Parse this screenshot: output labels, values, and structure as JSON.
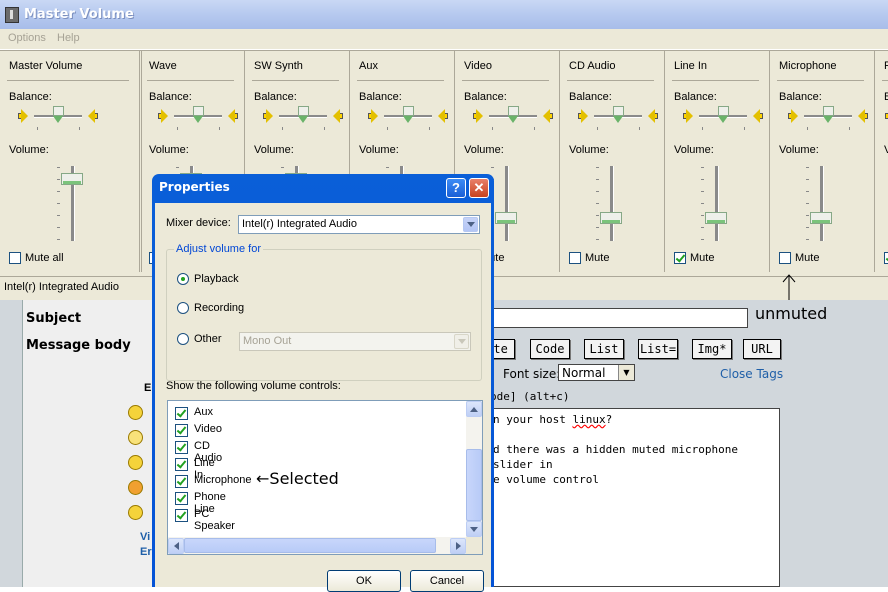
{
  "forum": {
    "subject_label": "Subject",
    "message_label": "Message body",
    "buttons": [
      "ote",
      "Code",
      "List",
      "List=",
      "Img*",
      "URL"
    ],
    "font_size_label": "Font size:",
    "font_size_value": "Normal",
    "close_tags": "Close Tags",
    "hint": "ode] (alt+c)",
    "body_lines": [
      "n your host linux?",
      "",
      "d there was a hidden muted microphone slider in",
      "e volume control"
    ],
    "emoticon_label_fragment": "E",
    "link_fragments": [
      "Vi",
      "Er"
    ]
  },
  "master_volume": {
    "title": "Master Volume",
    "menu": [
      "Options",
      "Help"
    ],
    "balance_label": "Balance:",
    "volume_label": "Volume:",
    "mute_label": "Mute",
    "mute_all_label": "Mute all",
    "status": "Intel(r) Integrated Audio",
    "columns": [
      {
        "name": "Master Volume",
        "mute": false,
        "volume": 0.9
      },
      {
        "name": "Wave",
        "mute": false,
        "volume": 0.9
      },
      {
        "name": "SW Synth",
        "mute": false,
        "volume": 0.9
      },
      {
        "name": "Aux",
        "mute": false,
        "volume": 0.3
      },
      {
        "name": "Video",
        "mute": false,
        "volume": 0.3
      },
      {
        "name": "CD Audio",
        "mute": false,
        "volume": 0.3
      },
      {
        "name": "Line In",
        "mute": true,
        "volume": 0.3
      },
      {
        "name": "Microphone",
        "mute": false,
        "volume": 0.3
      },
      {
        "name": "P",
        "mute": true,
        "volume": 0.3
      }
    ]
  },
  "annotations": {
    "unmuted": "unmuted",
    "selected": "←Selected"
  },
  "properties": {
    "title": "Properties",
    "help": "?",
    "close": "✕",
    "mixer_label": "Mixer device:",
    "mixer_value": "Intel(r) Integrated Audio",
    "adjust_legend": "Adjust volume for",
    "radios": [
      {
        "label": "Playback",
        "selected": true
      },
      {
        "label": "Recording",
        "selected": false
      },
      {
        "label": "Other",
        "selected": false
      }
    ],
    "other_value": "Mono Out",
    "show_label": "Show the following volume controls:",
    "controls": [
      {
        "label": "Aux",
        "checked": true
      },
      {
        "label": "Video",
        "checked": true
      },
      {
        "label": "CD Audio",
        "checked": true
      },
      {
        "label": "Line In",
        "checked": true
      },
      {
        "label": "Microphone",
        "checked": true
      },
      {
        "label": "Phone Line",
        "checked": true
      },
      {
        "label": "PC Speaker",
        "checked": true
      }
    ],
    "ok": "OK",
    "cancel": "Cancel"
  }
}
